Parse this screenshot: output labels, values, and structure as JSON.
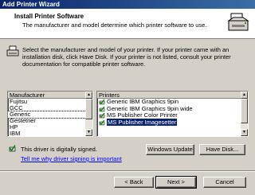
{
  "window": {
    "title": "Add Printer Wizard"
  },
  "header": {
    "title": "Install Printer Software",
    "subtitle": "The manufacturer and model determine which printer software to use."
  },
  "intro": "Select the manufacturer and model of your printer. If your printer came with an installation disk, click Have Disk. If your printer is not listed, consult your printer documentation for compatible printer software.",
  "manufacturers": {
    "header": "Manufacturer",
    "items": [
      "Fujitsu",
      "GCC",
      "Generic",
      "Gestetner",
      "HP",
      "IBM"
    ],
    "selected": "Generic"
  },
  "printers": {
    "header": "Printers",
    "items": [
      "Generic IBM Graphics 9pin",
      "Generic IBM Graphics 9pin wide",
      "MS Publisher Color Printer",
      "MS Publisher Imagesetter"
    ],
    "selected": "MS Publisher Imagesetter"
  },
  "signed_text": "This driver is digitally signed.",
  "signing_link": "Tell me why driver signing is important",
  "buttons": {
    "windows_update": "Windows Update",
    "have_disk": "Have Disk...",
    "back": "< Back",
    "next": "Next >",
    "cancel": "Cancel"
  },
  "colors": {
    "titlebar": "#0a246a",
    "selection": "#0a246a",
    "link": "#0000ff"
  }
}
